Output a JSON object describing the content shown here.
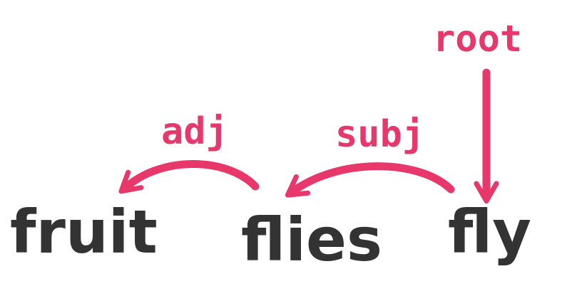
{
  "colors": {
    "word": "#333333",
    "relation": "#e8376b",
    "background": "#ffffff"
  },
  "words": [
    {
      "id": "w-fruit",
      "text": "fruit"
    },
    {
      "id": "w-flies",
      "text": "flies"
    },
    {
      "id": "w-fly",
      "text": "fly"
    }
  ],
  "relations": [
    {
      "id": "rel-root",
      "label": "root",
      "type": "root",
      "head": null,
      "dependent": "w-fly"
    },
    {
      "id": "rel-subj",
      "label": "subj",
      "type": "arc",
      "head": "w-fly",
      "dependent": "w-flies"
    },
    {
      "id": "rel-adj",
      "label": "adj",
      "type": "arc",
      "head": "w-flies",
      "dependent": "w-fruit"
    }
  ]
}
